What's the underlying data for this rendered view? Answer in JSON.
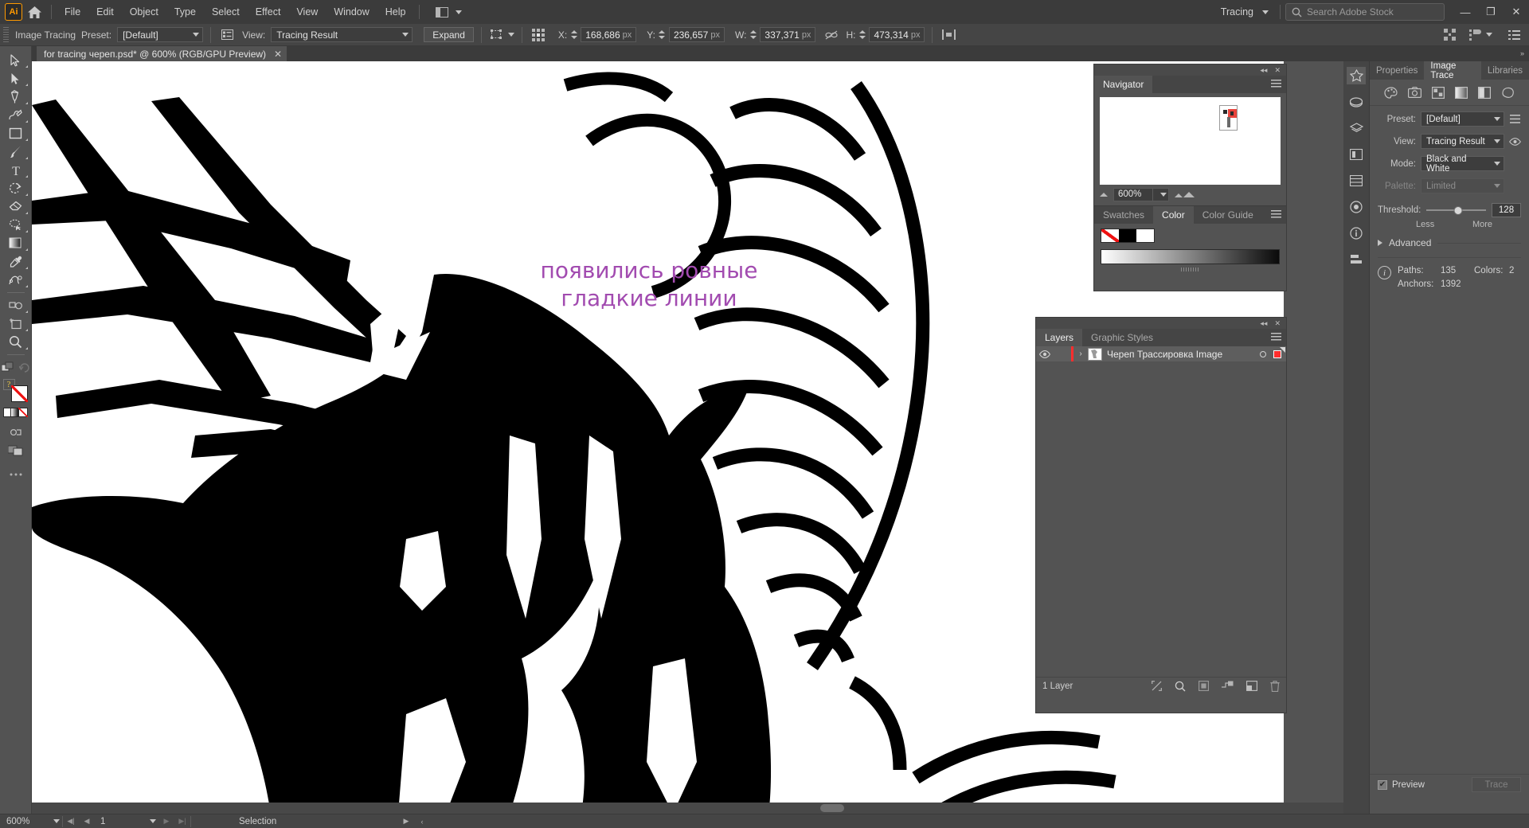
{
  "app": {
    "logo": "Ai",
    "home_icon": "home-icon",
    "workspace": "Tracing",
    "search_placeholder": "Search Adobe Stock",
    "search_icon": "search-icon",
    "minimize": "—",
    "restore": "❐",
    "close": "✕"
  },
  "menu": {
    "items": [
      "File",
      "Edit",
      "Object",
      "Type",
      "Select",
      "Effect",
      "View",
      "Window",
      "Help"
    ]
  },
  "control_bar": {
    "title": "Image Tracing",
    "preset_label": "Preset:",
    "preset_value": "[Default]",
    "panel_icon": "image-trace-panel-icon",
    "view_label": "View:",
    "view_value": "Tracing Result",
    "expand_label": "Expand",
    "transform_icon": "transform-icon",
    "align_icon": "align-grid-icon",
    "x_label": "X:",
    "x_value": "168,686",
    "y_label": "Y:",
    "y_value": "236,657",
    "w_label": "W:",
    "w_value": "337,371",
    "h_label": "H:",
    "h_value": "473,314",
    "unit": "px",
    "link_icon": "unlink-icon",
    "distribute_icon": "distribute-icon",
    "arrange_docs_icon": "arrange-documents-icon",
    "properties_icon": "properties-icon",
    "more_options_icon": "more-options-icon"
  },
  "toolbar": {
    "tools": [
      {
        "name": "selection-tool",
        "selected": false
      },
      {
        "name": "direct-selection-tool",
        "selected": false
      },
      {
        "name": "pen-tool",
        "selected": false
      },
      {
        "name": "curvature-tool",
        "selected": false
      },
      {
        "name": "rectangle-tool",
        "selected": false
      },
      {
        "name": "paintbrush-tool",
        "selected": false
      },
      {
        "name": "type-tool",
        "selected": false
      },
      {
        "name": "rotate-tool",
        "selected": false
      },
      {
        "name": "eraser-tool",
        "selected": false
      },
      {
        "name": "lasso-tool",
        "selected": false
      },
      {
        "name": "gradient-tool",
        "selected": false
      },
      {
        "name": "eyedropper-tool",
        "selected": false
      },
      {
        "name": "blend-tool",
        "selected": false
      },
      {
        "name": "symbol-sprayer-tool",
        "selected": false
      },
      {
        "name": "artboard-tool",
        "selected": false
      },
      {
        "name": "zoom-tool",
        "selected": false
      }
    ],
    "fill_color": "#ffffff",
    "stroke_color": "#ffffff",
    "more_tools_icon": "more-tools-icon"
  },
  "document": {
    "tab_title": "for tracing череп.psd* @ 600% (RGB/GPU Preview)",
    "close_icon": "✕"
  },
  "canvas": {
    "annotation_lines": [
      "появились ровные",
      "гладкие линии"
    ],
    "annotation_color": "#a24bb0"
  },
  "statusbar": {
    "zoom": "600%",
    "page": "1",
    "status": "Selection",
    "first_icon": "first-page-icon",
    "prev_icon": "previous-page-icon",
    "next_icon": "next-page-icon",
    "last_icon": "last-page-icon",
    "play_icon": "play-icon",
    "collapse_icon": "collapse-icon"
  },
  "navigator": {
    "tab": "Navigator",
    "zoom": "600%",
    "zoom_out_icon": "zoom-out-icon",
    "zoom_in_icon": "zoom-in-icon",
    "menu_icon": "panel-menu-icon",
    "collapse_icon": "◂◂",
    "close_icon": "✕"
  },
  "color_panel": {
    "tabs": [
      "Swatches",
      "Color",
      "Color Guide"
    ],
    "active_tab": "Color",
    "none_swatch": "none-color-swatch",
    "black_swatch": "#000000",
    "white_swatch": "#ffffff",
    "ramp_from": "#ffffff",
    "ramp_to": "#000000",
    "menu_icon": "panel-menu-icon"
  },
  "layers_panel": {
    "tabs": [
      "Layers",
      "Graphic Styles"
    ],
    "active_tab": "Layers",
    "layer": {
      "name": "Череп Трассировка Image",
      "visible_icon": "eye-icon",
      "expand_icon": "›",
      "color": "#ff2d2d",
      "target_icon": "target-circle-icon",
      "selection_icon": "selection-square-icon"
    },
    "footer_count": "1 Layer",
    "footer_icons": [
      "locate-object-icon",
      "search-icon",
      "make-mask-icon",
      "create-sublayer-icon",
      "new-layer-icon",
      "delete-layer-icon"
    ],
    "collapse_icon": "◂◂",
    "close_icon": "✕",
    "menu_icon": "panel-menu-icon"
  },
  "right_rail": {
    "icons": [
      "properties-rail-icon",
      "libraries-rail-icon",
      "layers-rail-icon",
      "swatches-rail-icon",
      "brushes-rail-icon",
      "symbols-rail-icon",
      "info-rail-icon",
      "align-rail-icon"
    ]
  },
  "image_trace": {
    "tabs": [
      "Properties",
      "Image Trace",
      "Libraries"
    ],
    "active_tab": "Image Trace",
    "mode_icons": [
      "auto-color-icon",
      "high-fidelity-photo-icon",
      "low-fidelity-photo-icon",
      "grayscale-icon",
      "black-and-white-icon",
      "outline-icon"
    ],
    "preset_label": "Preset:",
    "preset_value": "[Default]",
    "preset_menu_icon": "preset-menu-icon",
    "view_label": "View:",
    "view_value": "Tracing Result",
    "view_eye_icon": "eye-icon",
    "mode_label": "Mode:",
    "mode_value": "Black and White",
    "palette_label": "Palette:",
    "palette_value": "Limited",
    "threshold_label": "Threshold:",
    "threshold_value": "128",
    "threshold_less": "Less",
    "threshold_more": "More",
    "advanced_label": "Advanced",
    "stats": {
      "paths_label": "Paths:",
      "paths_value": "135",
      "colors_label": "Colors:",
      "colors_value": "2",
      "anchors_label": "Anchors:",
      "anchors_value": "1392"
    },
    "preview_label": "Preview",
    "preview_checked": true,
    "trace_label": "Trace",
    "collapse_icon": "»"
  }
}
